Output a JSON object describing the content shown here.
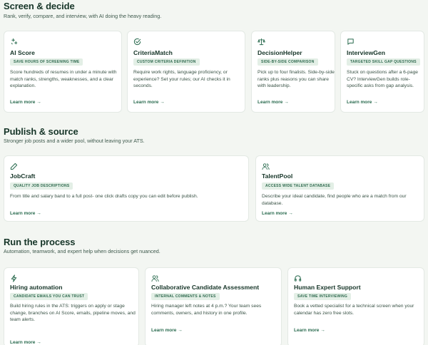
{
  "sections": [
    {
      "title": "Screen & decide",
      "subtitle": "Rank, verify, compare, and interview, with AI doing the heavy reading.",
      "cards": [
        {
          "icon": "sparkle-icon",
          "title": "AI Score",
          "badge": "SAVE HOURS OF SCREENING TIME",
          "desc": "Score hundreds of resumes in under a minute with match ranks, strengths, weaknesses, and a clear explanation.",
          "link": "Learn more →"
        },
        {
          "icon": "check-circle-icon",
          "title": "CriteriaMatch",
          "badge": "CUSTOM CRITERIA DEFINITION",
          "desc": "Require work rights, language proficiency, or experience? Set your rules; our AI checks it in seconds.",
          "link": "Learn more →"
        },
        {
          "icon": "scale-icon",
          "title": "DecisionHelper",
          "badge": "SIDE-BY-SIDE COMPARISON",
          "desc": "Pick up to four finalists. Side-by-side ranks plus reasons you can share with leadership.",
          "link": "Learn more →"
        },
        {
          "icon": "chat-icon",
          "title": "InterviewGen",
          "badge": "TARGETED SKILL GAP QUESTIONS",
          "desc": "Stuck on questions after a 6-page CV? InterviewGen builds role-specific asks from gap analysis.",
          "link": "Learn more →"
        }
      ]
    },
    {
      "title": "Publish & source",
      "subtitle": "Stronger job posts and a wider pool, without leaving your ATS.",
      "cards": [
        {
          "icon": "pen-icon",
          "title": "JobCraft",
          "badge": "QUALITY JOB DESCRIPTIONS",
          "desc": "From title and salary band to a full post- one click drafts copy you can edit before publish.",
          "link": "Learn more →"
        },
        {
          "icon": "users-icon",
          "title": "TalentPool",
          "badge": "ACCESS WIDE TALENT DATABASE",
          "desc": "Describe your ideal candidate, find people who are a match from our database.",
          "link": "Learn more →"
        }
      ]
    },
    {
      "title": "Run the process",
      "subtitle": "Automation, teamwork, and expert help when decisions get nuanced.",
      "cards": [
        {
          "icon": "lightning-icon",
          "title": "Hiring automation",
          "badge": "CANDIDATE EMAILS YOU CAN TRUST",
          "desc": "Build hiring rules in the ATS: triggers on apply or stage change, branches on AI Score, emails, pipeline moves, and team alerts.",
          "link": "Learn more →"
        },
        {
          "icon": "users-icon",
          "title": "Collaborative Candidate Assessment",
          "badge": "INTERNAL COMMENTS & NOTES",
          "desc": "Hiring manager left notes at 4 p.m.? Your team sees comments, owners, and history in one profile.",
          "link": "Learn more →"
        },
        {
          "icon": "headphones-icon",
          "title": "Human Expert Support",
          "badge": "SAVE TIME INTERVIEWING",
          "desc": "Book a vetted specialist for a technical screen when your calendar has zero free slots.",
          "link": "Learn more →"
        }
      ]
    }
  ]
}
